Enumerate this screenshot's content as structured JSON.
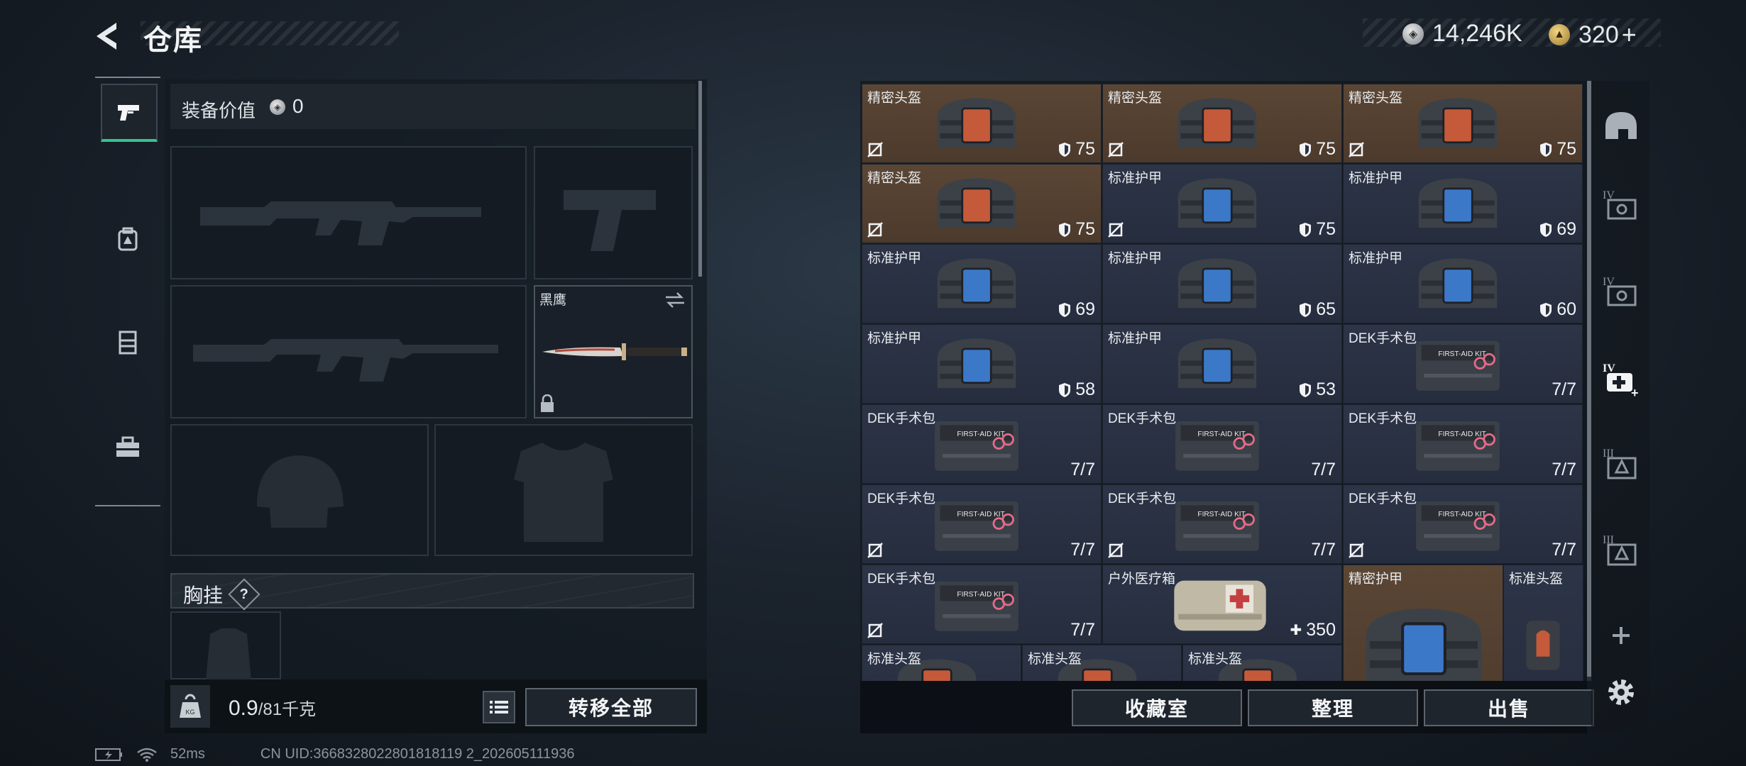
{
  "header": {
    "title": "仓库",
    "silver_amount": "14,246K",
    "gold_amount": "320",
    "gold_plus": "+"
  },
  "left_tabs": [
    {
      "name": "pistol",
      "active": true
    },
    {
      "name": "backpack",
      "active": false
    },
    {
      "name": "vest",
      "active": false
    },
    {
      "name": "case",
      "active": false
    }
  ],
  "equipment": {
    "value_label": "装备价值",
    "value": "0",
    "melee_name": "黑鹰",
    "chest_label": "胸挂",
    "chest_help": "?"
  },
  "weight": {
    "current": "0.9",
    "max": "/81千克"
  },
  "buttons": {
    "transfer_all": "转移全部",
    "collection": "收藏室",
    "organize": "整理",
    "sell": "出售"
  },
  "grid": {
    "rows": [
      [
        {
          "name": "精密头盔",
          "value": "75",
          "type": "shield",
          "tone": "brown",
          "icon": "helmet-bag",
          "noins": true
        },
        {
          "name": "精密头盔",
          "value": "75",
          "type": "shield",
          "tone": "brown",
          "icon": "helmet-bag",
          "noins": true
        },
        {
          "name": "精密头盔",
          "value": "75",
          "type": "shield",
          "tone": "brown",
          "icon": "helmet-bag",
          "noins": true
        }
      ],
      [
        {
          "name": "精密头盔",
          "value": "75",
          "type": "shield",
          "tone": "brown",
          "icon": "helmet-bag",
          "noins": true
        },
        {
          "name": "标准护甲",
          "value": "75",
          "type": "shield",
          "tone": "navy",
          "icon": "armor-bag",
          "noins": true
        },
        {
          "name": "标准护甲",
          "value": "69",
          "type": "shield",
          "tone": "navy",
          "icon": "armor-bag",
          "noins": false
        }
      ],
      [
        {
          "name": "标准护甲",
          "value": "69",
          "type": "shield",
          "tone": "navy",
          "icon": "armor-bag",
          "noins": false
        },
        {
          "name": "标准护甲",
          "value": "65",
          "type": "shield",
          "tone": "navy",
          "icon": "armor-bag",
          "noins": false
        },
        {
          "name": "标准护甲",
          "value": "60",
          "type": "shield",
          "tone": "navy",
          "icon": "armor-bag",
          "noins": false
        }
      ],
      [
        {
          "name": "标准护甲",
          "value": "58",
          "type": "shield",
          "tone": "navy",
          "icon": "armor-bag",
          "noins": false
        },
        {
          "name": "标准护甲",
          "value": "53",
          "type": "shield",
          "tone": "navy",
          "icon": "armor-bag",
          "noins": false
        },
        {
          "name": "DEK手术包",
          "value": "7/7",
          "type": "count",
          "tone": "navy",
          "icon": "first-aid-kit",
          "noins": false
        }
      ],
      [
        {
          "name": "DEK手术包",
          "value": "7/7",
          "type": "count",
          "tone": "navy",
          "icon": "first-aid-kit",
          "noins": false
        },
        {
          "name": "DEK手术包",
          "value": "7/7",
          "type": "count",
          "tone": "navy",
          "icon": "first-aid-kit",
          "noins": false
        },
        {
          "name": "DEK手术包",
          "value": "7/7",
          "type": "count",
          "tone": "navy",
          "icon": "first-aid-kit",
          "noins": false
        }
      ],
      [
        {
          "name": "DEK手术包",
          "value": "7/7",
          "type": "count",
          "tone": "navy",
          "icon": "first-aid-kit",
          "noins": true
        },
        {
          "name": "DEK手术包",
          "value": "7/7",
          "type": "count",
          "tone": "navy",
          "icon": "first-aid-kit",
          "noins": true
        },
        {
          "name": "DEK手术包",
          "value": "7/7",
          "type": "count",
          "tone": "navy",
          "icon": "first-aid-kit",
          "noins": true
        }
      ],
      [
        {
          "name": "DEK手术包",
          "value": "7/7",
          "type": "count",
          "tone": "navy",
          "icon": "first-aid-kit",
          "noins": true
        },
        {
          "name": "户外医疗箱",
          "value": "350",
          "type": "heal",
          "tone": "navy",
          "icon": "medical-box",
          "noins": false
        }
      ]
    ],
    "tall_items": [
      {
        "name": "精密护甲",
        "tone": "brown",
        "icon": "armor-bag-large"
      },
      {
        "name": "标准头盔",
        "tone": "navy",
        "icon": "helmet-tall"
      }
    ],
    "partial_row": [
      "标准头盔",
      "标准头盔",
      "标准头盔"
    ]
  },
  "right_rail": [
    "helmet-filter-icon",
    "level-iv-rig-icon",
    "level-iv-rig-icon-2",
    "level-iv-medkit-icon",
    "level-iii-rig-icon",
    "level-iii-rig-icon-2",
    "add-icon",
    "settings-icon"
  ],
  "right_rail_labels": {
    "level_iv": "IV",
    "level_iii": "III"
  },
  "status": {
    "ping": "52ms",
    "uid": "CN UID:3668328022801818119 2_202605111936"
  }
}
